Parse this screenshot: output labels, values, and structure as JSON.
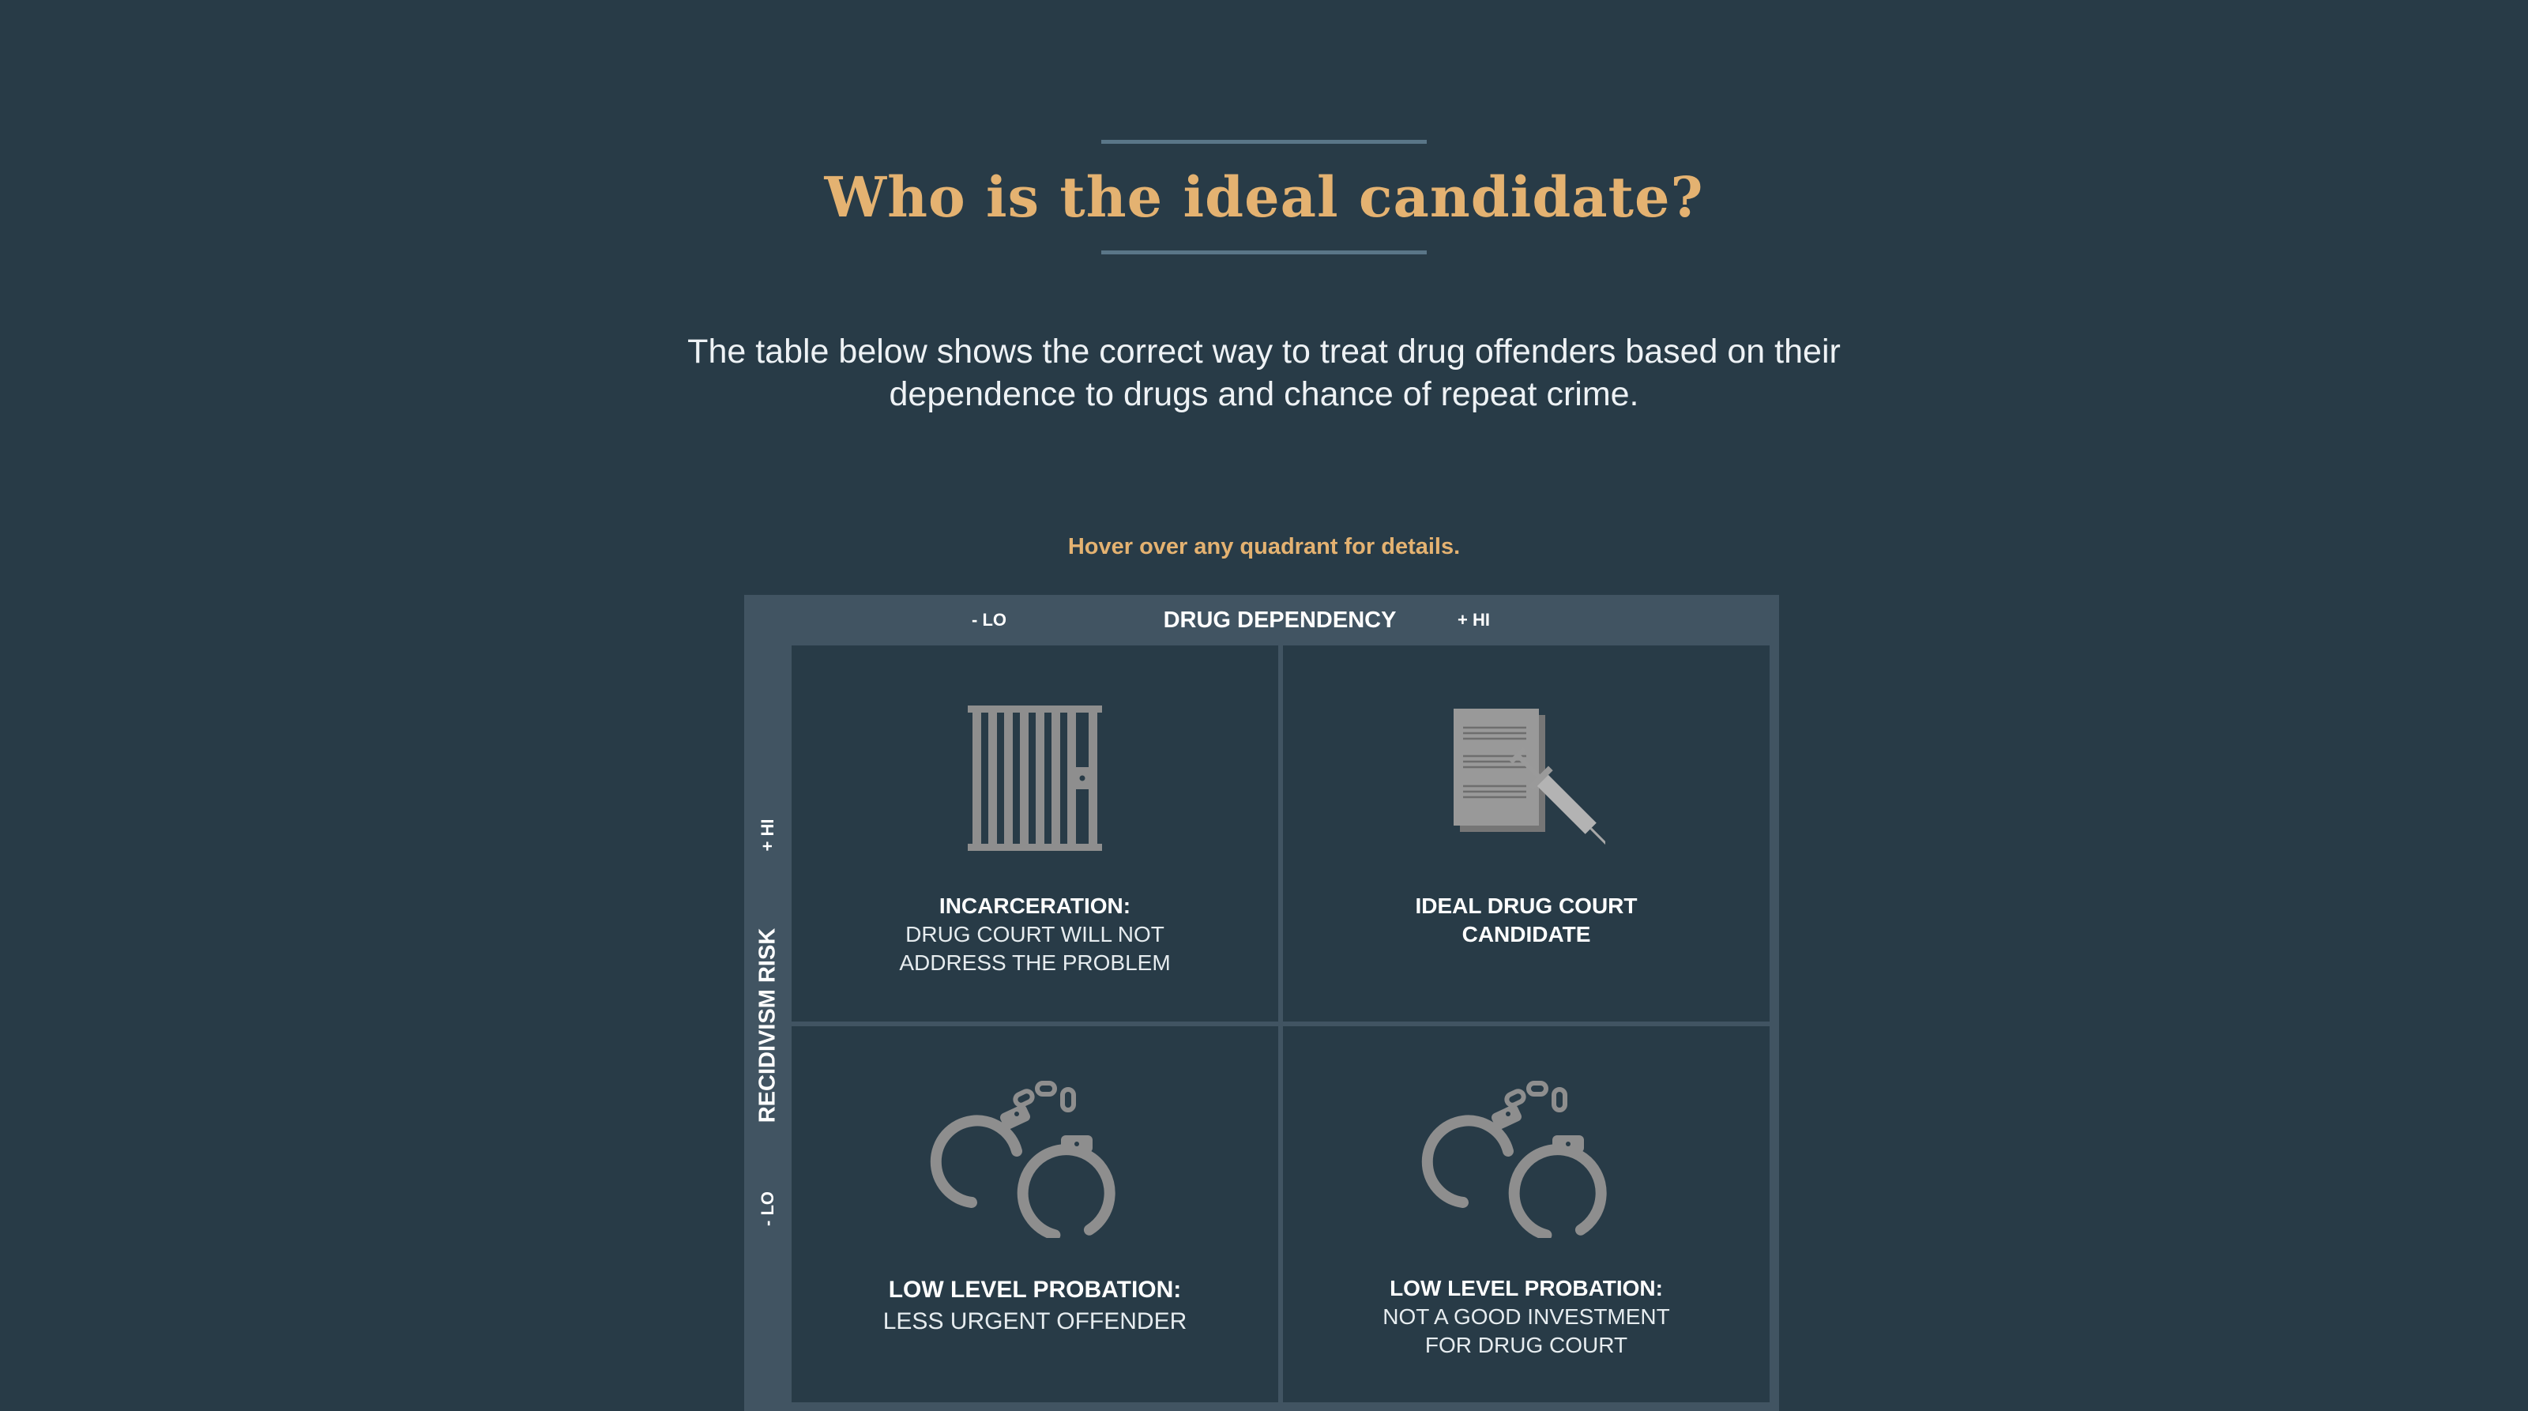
{
  "header": {
    "title": "Who is the ideal candidate?",
    "accent_color": "#e4b271",
    "rule_color": "#5a7688"
  },
  "intro": {
    "text": "The table below shows the correct way to treat drug offenders based on their dependence to drugs and chance of repeat crime."
  },
  "hint": {
    "text": "Hover over any quadrant for details."
  },
  "matrix": {
    "x_axis": {
      "title": "DRUG DEPENDENCY",
      "low_label": "- LO",
      "high_label": "+ HI"
    },
    "y_axis": {
      "title": "RECIDIVISM RISK",
      "low_label": "- LO",
      "high_label": "+ HI"
    },
    "quadrants": [
      {
        "position": "high-risk / low-dependency",
        "icon": "jail-cell-icon",
        "heading": "INCARCERATION:",
        "lines": [
          "DRUG COURT WILL NOT",
          "ADDRESS THE PROBLEM"
        ]
      },
      {
        "position": "high-risk / high-dependency",
        "icon": "documents-syringe-icon",
        "heading_lines": [
          "IDEAL DRUG COURT",
          "CANDIDATE"
        ]
      },
      {
        "position": "low-risk / low-dependency",
        "icon": "handcuffs-icon",
        "heading": "LOW LEVEL PROBATION:",
        "lines": [
          "LESS URGENT OFFENDER"
        ]
      },
      {
        "position": "low-risk / high-dependency",
        "icon": "handcuffs-icon",
        "heading": "LOW LEVEL PROBATION:",
        "lines": [
          "NOT A GOOD INVESTMENT",
          "FOR DRUG COURT"
        ]
      }
    ]
  }
}
